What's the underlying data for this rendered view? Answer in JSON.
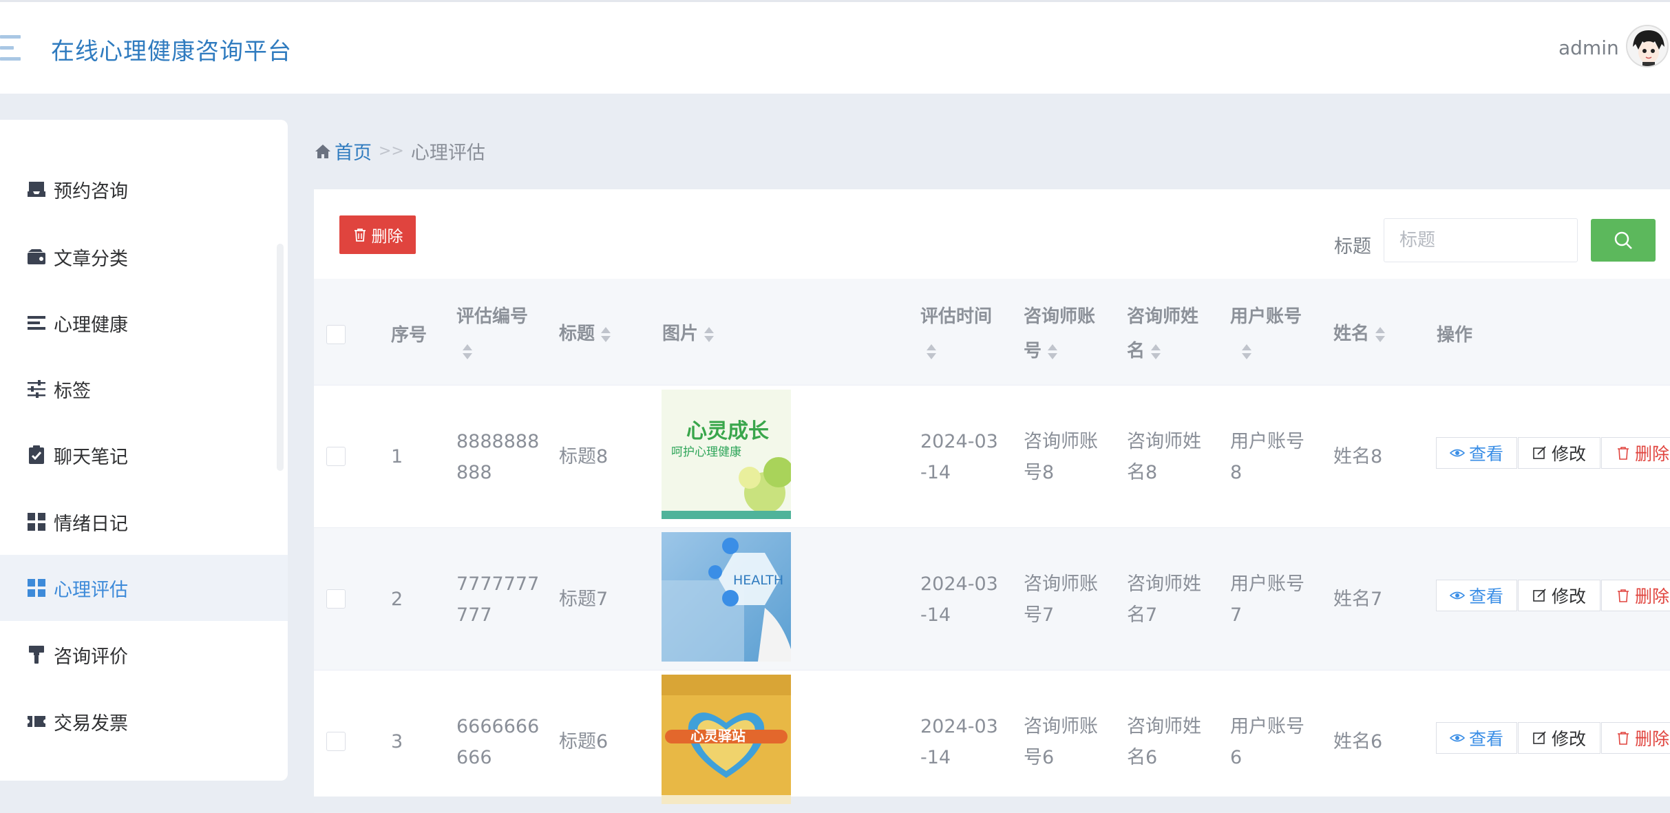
{
  "header": {
    "app_title": "在线心理健康咨询平台",
    "user": "admin"
  },
  "sidebar": {
    "items": [
      {
        "label": "预约咨询",
        "icon": "inbox-icon"
      },
      {
        "label": "文章分类",
        "icon": "wallet-icon"
      },
      {
        "label": "心理健康",
        "icon": "list-icon"
      },
      {
        "label": "标签",
        "icon": "sliders-icon"
      },
      {
        "label": "聊天笔记",
        "icon": "clipboard-check-icon"
      },
      {
        "label": "情绪日记",
        "icon": "grid-icon"
      },
      {
        "label": "心理评估",
        "icon": "grid-icon",
        "active": true
      },
      {
        "label": "咨询评价",
        "icon": "paint-roller-icon"
      },
      {
        "label": "交易发票",
        "icon": "ticket-icon"
      }
    ]
  },
  "breadcrumb": {
    "home": "首页",
    "separator": ">>",
    "current": "心理评估"
  },
  "toolbar": {
    "delete_label": "删除",
    "search_label": "标题",
    "search_placeholder": "标题"
  },
  "table": {
    "headers": {
      "index": "序号",
      "code": "评估编号",
      "title": "标题",
      "image": "图片",
      "time_a": "评估时间",
      "counselor_acc_a": "咨询师账",
      "counselor_acc_b": "号",
      "counselor_name_a": "咨询师姓",
      "counselor_name_b": "名",
      "user_acc": "用户账号",
      "name": "姓名",
      "actions": "操作"
    },
    "rows": [
      {
        "index": "1",
        "code_a": "8888888",
        "code_b": "888",
        "title": "标题8",
        "image_title": "心灵成长",
        "image_sub": "呵护心理健康",
        "time_a": "2024-03",
        "time_b": "-14",
        "counselor_acc_a": "咨询师账",
        "counselor_acc_b": "号8",
        "counselor_name_a": "咨询师姓",
        "counselor_name_b": "名8",
        "user_acc_a": "用户账号",
        "user_acc_b": "8",
        "name": "姓名8"
      },
      {
        "index": "2",
        "code_a": "7777777",
        "code_b": "777",
        "title": "标题7",
        "image_title": "HEALTH",
        "time_a": "2024-03",
        "time_b": "-14",
        "counselor_acc_a": "咨询师账",
        "counselor_acc_b": "号7",
        "counselor_name_a": "咨询师姓",
        "counselor_name_b": "名7",
        "user_acc_a": "用户账号",
        "user_acc_b": "7",
        "name": "姓名7"
      },
      {
        "index": "3",
        "code_a": "6666666",
        "code_b": "666",
        "title": "标题6",
        "image_title": "心灵驿站",
        "time_a": "2024-03",
        "time_b": "-14",
        "counselor_acc_a": "咨询师账",
        "counselor_acc_b": "号6",
        "counselor_name_a": "咨询师姓",
        "counselor_name_b": "名6",
        "user_acc_a": "用户账号",
        "user_acc_b": "6",
        "name": "姓名6"
      }
    ],
    "actions": {
      "view": "查看",
      "edit": "修改",
      "delete": "删除"
    }
  },
  "colors": {
    "accent": "#2f7bbf",
    "danger": "#e0443e",
    "success": "#5cb85c",
    "active_bg": "#eef2f8"
  }
}
